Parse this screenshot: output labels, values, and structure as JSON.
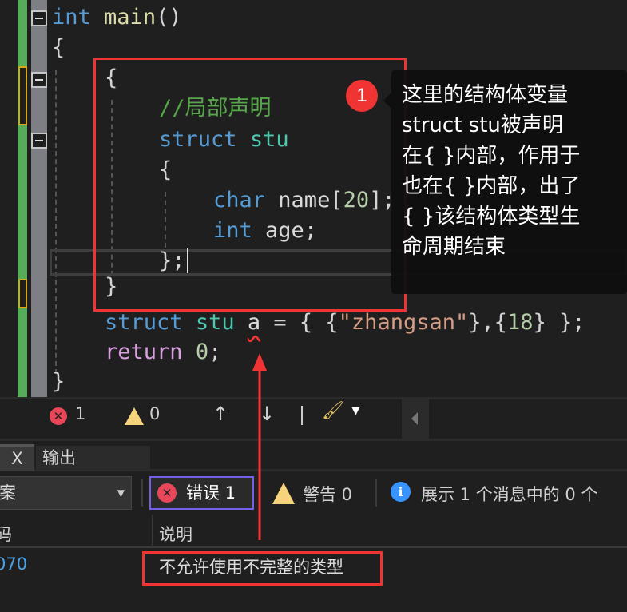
{
  "editor": {
    "lines": {
      "l1": {
        "kw": "int",
        "fn": "main",
        "rest": "()"
      },
      "l2": "{",
      "l3": "{",
      "l4": "//局部声明",
      "l5": {
        "kw": "struct",
        "ty": "stu"
      },
      "l6": "{",
      "l7": {
        "kw": "char",
        "id": "name",
        "b1": "[",
        "num": "20",
        "b2": "];"
      },
      "l8": {
        "kw": "int",
        "id": "age;"
      },
      "l9": "};",
      "l10": "}",
      "l11": {
        "kw": "struct",
        "ty": "stu",
        "var": "a",
        "eq": " = { {",
        "str": "\"zhangsan\"",
        "mid": "},{",
        "num": "18",
        "end": "} };"
      },
      "l12": {
        "rt": "return",
        "num": "0",
        "end": ";"
      },
      "l13": "}"
    }
  },
  "annotation": {
    "badge": "1",
    "text": [
      "这里的结构体变量",
      "struct stu被声明",
      "在{ }内部，作用于",
      "也在{ }内部，出了",
      "{ }该结构体类型生",
      "命周期结束"
    ]
  },
  "status_bar": {
    "errors": "1",
    "warnings": "0"
  },
  "tabs": [
    {
      "label": "X"
    },
    {
      "label": "输出"
    }
  ],
  "error_list": {
    "scope_dropdown": "案",
    "errors_filter": "错误 1",
    "warnings_filter": "警告 0",
    "messages_filter": "展示 1 个消息中的 0 个",
    "columns": [
      "码",
      "说明"
    ],
    "rows": [
      {
        "code": "070",
        "description": "不允许使用不完整的类型"
      }
    ]
  },
  "colors": {
    "annotation_red": "#f03434",
    "filter_active_border": "#7160e8"
  }
}
